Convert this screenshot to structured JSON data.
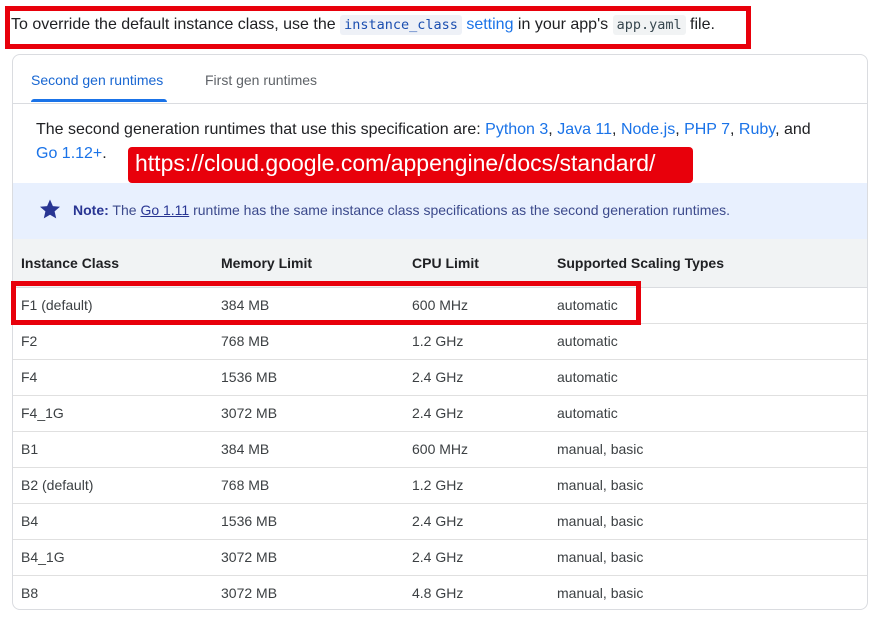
{
  "intro": {
    "prefix": "To override the default instance class, use the ",
    "code1": "instance_class",
    "link": "setting",
    "middle": " in your app's ",
    "code2": "app.yaml",
    "suffix": " file."
  },
  "tabs": [
    {
      "label": "Second gen runtimes",
      "active": true
    },
    {
      "label": "First gen runtimes",
      "active": false
    }
  ],
  "description": {
    "prefix": "The second generation runtimes that use this specification are: ",
    "runtimes": [
      "Python 3",
      "Java 11",
      "Node.js",
      "PHP 7",
      "Ruby",
      "Go 1.12+"
    ],
    "sep": ", ",
    "and": ", and ",
    "end": "."
  },
  "url_banner": "https://cloud.google.com/appengine/docs/standard/",
  "note": {
    "icon": "star-icon",
    "label": "Note:",
    "prefix": "The ",
    "link": "Go 1.11",
    "suffix": " runtime has the same instance class specifications as the second generation runtimes."
  },
  "table": {
    "headers": [
      "Instance Class",
      "Memory Limit",
      "CPU Limit",
      "Supported Scaling Types"
    ],
    "rows": [
      [
        "F1 (default)",
        "384 MB",
        "600 MHz",
        "automatic"
      ],
      [
        "F2",
        "768 MB",
        "1.2 GHz",
        "automatic"
      ],
      [
        "F4",
        "1536 MB",
        "2.4 GHz",
        "automatic"
      ],
      [
        "F4_1G",
        "3072 MB",
        "2.4 GHz",
        "automatic"
      ],
      [
        "B1",
        "384 MB",
        "600 MHz",
        "manual, basic"
      ],
      [
        "B2 (default)",
        "768 MB",
        "1.2 GHz",
        "manual, basic"
      ],
      [
        "B4",
        "1536 MB",
        "2.4 GHz",
        "manual, basic"
      ],
      [
        "B4_1G",
        "3072 MB",
        "2.4 GHz",
        "manual, basic"
      ],
      [
        "B8",
        "3072 MB",
        "4.8 GHz",
        "manual, basic"
      ]
    ]
  },
  "colors": {
    "highlight": "#e8000b",
    "link": "#1a73e8",
    "note_bg": "#e8f0fe",
    "header_bg": "#f1f3f4"
  }
}
